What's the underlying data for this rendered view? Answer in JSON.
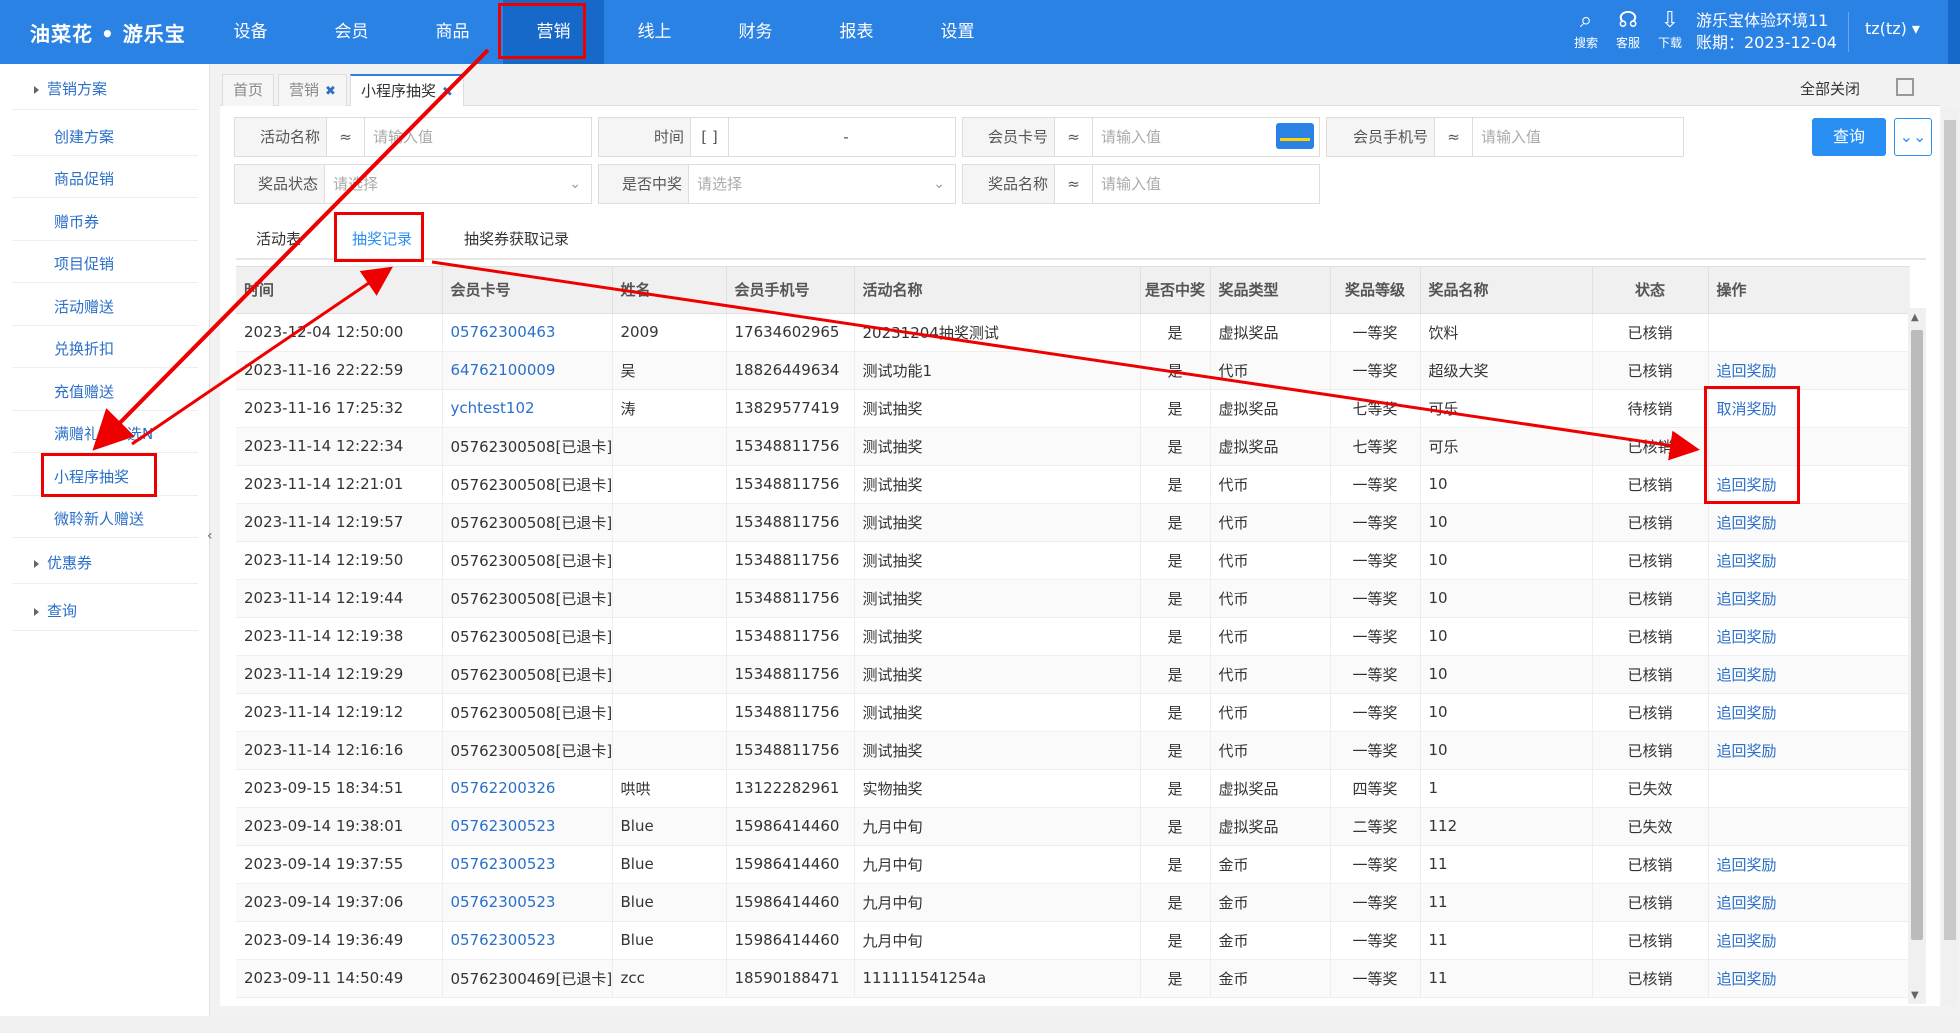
{
  "topbar": {
    "logo": "油菜花 • 游乐宝",
    "nav": [
      "设备",
      "会员",
      "商品",
      "营销",
      "线上",
      "财务",
      "报表",
      "设置"
    ],
    "icons": [
      {
        "name": "search-icon",
        "label": "搜索",
        "glyph": "⌕"
      },
      {
        "name": "headset-icon",
        "label": "客服",
        "glyph": "☊"
      },
      {
        "name": "download-icon",
        "label": "下载",
        "glyph": "⇩"
      }
    ],
    "env_name": "游乐宝体验环境11",
    "account_period": "账期：2023-12-04",
    "user": "tz(tz)",
    "user_caret": "▾"
  },
  "sidebar": {
    "group1": "营销方案",
    "items": [
      "创建方案",
      "商品促销",
      "赠币券",
      "项目促销",
      "活动赠送",
      "兑换折扣",
      "充值赠送",
      "满赠礼品M选N",
      "小程序抽奖",
      "微聆新人赠送"
    ],
    "group2": "优惠券",
    "group3": "查询"
  },
  "tabs": {
    "home": "首页",
    "marketing": "营销",
    "lottery": "小程序抽奖",
    "close_glyph": "✖",
    "close_all": "全部关闭"
  },
  "filters": {
    "activity_name": {
      "label": "活动名称",
      "op": "≈",
      "placeholder": "请输入值"
    },
    "time": {
      "label": "时间",
      "op": "[ ]",
      "value": "-"
    },
    "card_no": {
      "label": "会员卡号",
      "op": "≈",
      "placeholder": "请输入值"
    },
    "phone": {
      "label": "会员手机号",
      "op": "≈",
      "placeholder": "请输入值"
    },
    "prize_status": {
      "label": "奖品状态",
      "placeholder": "请选择"
    },
    "is_winning": {
      "label": "是否中奖",
      "placeholder": "请选择"
    },
    "prize_name": {
      "label": "奖品名称",
      "op": "≈",
      "placeholder": "请输入值"
    },
    "query_btn": "查询",
    "more_glyph": "⌄⌄"
  },
  "subtabs": [
    "活动表",
    "抽奖记录",
    "抽奖券获取记录"
  ],
  "table": {
    "headers": [
      "时间",
      "会员卡号",
      "姓名",
      "会员手机号",
      "活动名称",
      "是否中奖",
      "奖品类型",
      "奖品等级",
      "奖品名称",
      "状态",
      "操作"
    ],
    "rows": [
      [
        "2023-12-04 12:50:00",
        "05762300463",
        "2009",
        "17634602965",
        "20231204抽奖测试",
        "是",
        "虚拟奖品",
        "一等奖",
        "饮料",
        "已核销",
        ""
      ],
      [
        "2023-11-16 22:22:59",
        "64762100009",
        "吴",
        "18826449634",
        "测试功能1",
        "是",
        "代币",
        "一等奖",
        "超级大奖",
        "已核销",
        "追回奖励"
      ],
      [
        "2023-11-16 17:25:32",
        "ychtest102",
        "涛",
        "13829577419",
        "测试抽奖",
        "是",
        "虚拟奖品",
        "七等奖",
        "可乐",
        "待核销",
        "取消奖励"
      ],
      [
        "2023-11-14 12:22:34",
        "05762300508[已退卡]",
        "",
        "15348811756",
        "测试抽奖",
        "是",
        "虚拟奖品",
        "七等奖",
        "可乐",
        "已核销",
        ""
      ],
      [
        "2023-11-14 12:21:01",
        "05762300508[已退卡]",
        "",
        "15348811756",
        "测试抽奖",
        "是",
        "代币",
        "一等奖",
        "10",
        "已核销",
        "追回奖励"
      ],
      [
        "2023-11-14 12:19:57",
        "05762300508[已退卡]",
        "",
        "15348811756",
        "测试抽奖",
        "是",
        "代币",
        "一等奖",
        "10",
        "已核销",
        "追回奖励"
      ],
      [
        "2023-11-14 12:19:50",
        "05762300508[已退卡]",
        "",
        "15348811756",
        "测试抽奖",
        "是",
        "代币",
        "一等奖",
        "10",
        "已核销",
        "追回奖励"
      ],
      [
        "2023-11-14 12:19:44",
        "05762300508[已退卡]",
        "",
        "15348811756",
        "测试抽奖",
        "是",
        "代币",
        "一等奖",
        "10",
        "已核销",
        "追回奖励"
      ],
      [
        "2023-11-14 12:19:38",
        "05762300508[已退卡]",
        "",
        "15348811756",
        "测试抽奖",
        "是",
        "代币",
        "一等奖",
        "10",
        "已核销",
        "追回奖励"
      ],
      [
        "2023-11-14 12:19:29",
        "05762300508[已退卡]",
        "",
        "15348811756",
        "测试抽奖",
        "是",
        "代币",
        "一等奖",
        "10",
        "已核销",
        "追回奖励"
      ],
      [
        "2023-11-14 12:19:12",
        "05762300508[已退卡]",
        "",
        "15348811756",
        "测试抽奖",
        "是",
        "代币",
        "一等奖",
        "10",
        "已核销",
        "追回奖励"
      ],
      [
        "2023-11-14 12:16:16",
        "05762300508[已退卡]",
        "",
        "15348811756",
        "测试抽奖",
        "是",
        "代币",
        "一等奖",
        "10",
        "已核销",
        "追回奖励"
      ],
      [
        "2023-09-15 18:34:51",
        "05762200326",
        "哄哄",
        "13122282961",
        "实物抽奖",
        "是",
        "虚拟奖品",
        "四等奖",
        "1",
        "已失效",
        ""
      ],
      [
        "2023-09-14 19:38:01",
        "05762300523",
        "Blue",
        "15986414460",
        "九月中旬",
        "是",
        "虚拟奖品",
        "二等奖",
        "112",
        "已失效",
        ""
      ],
      [
        "2023-09-14 19:37:55",
        "05762300523",
        "Blue",
        "15986414460",
        "九月中旬",
        "是",
        "金币",
        "一等奖",
        "11",
        "已核销",
        "追回奖励"
      ],
      [
        "2023-09-14 19:37:06",
        "05762300523",
        "Blue",
        "15986414460",
        "九月中旬",
        "是",
        "金币",
        "一等奖",
        "11",
        "已核销",
        "追回奖励"
      ],
      [
        "2023-09-14 19:36:49",
        "05762300523",
        "Blue",
        "15986414460",
        "九月中旬",
        "是",
        "金币",
        "一等奖",
        "11",
        "已核销",
        "追回奖励"
      ],
      [
        "2023-09-11 14:50:49",
        "05762300469[已退卡]",
        "zcc",
        "18590188471",
        "111111541254a",
        "是",
        "金币",
        "一等奖",
        "11",
        "已核销",
        "追回奖励"
      ]
    ]
  },
  "colors": {
    "brand": "#2a82e4",
    "link": "#2a6fc9",
    "annotation": "#e00000"
  }
}
